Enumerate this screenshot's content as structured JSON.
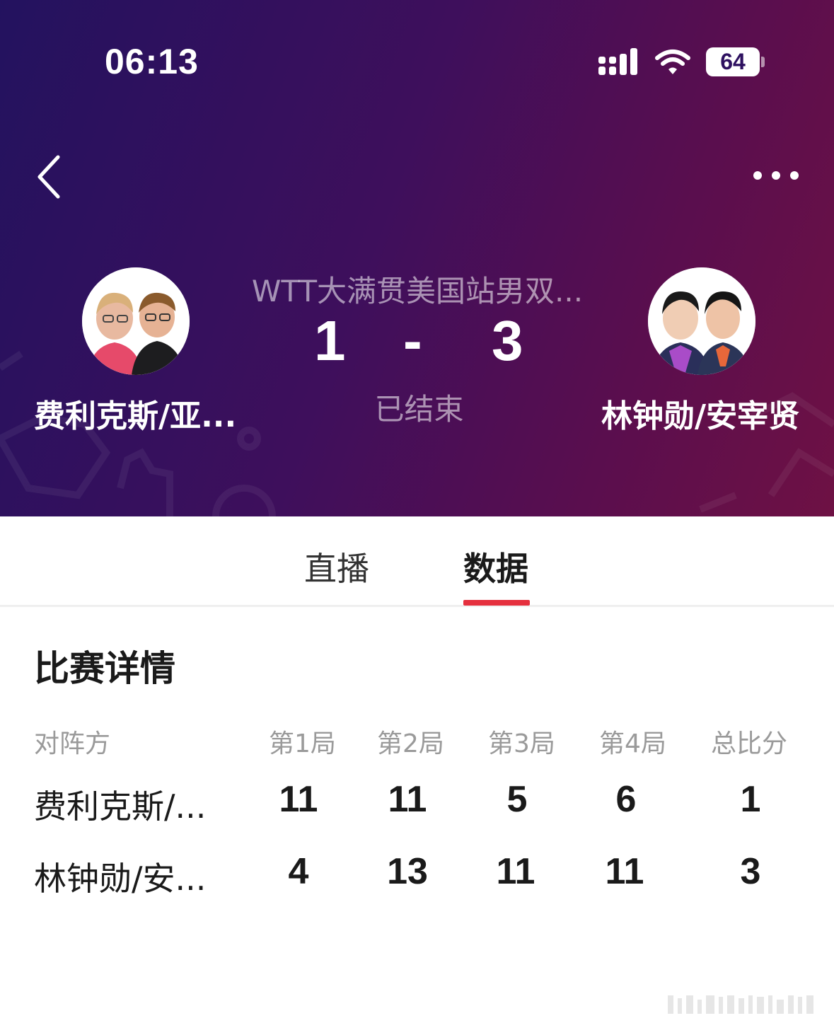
{
  "status_bar": {
    "time": "06:13",
    "battery": "64",
    "icons": [
      "signal-icon",
      "wifi-icon",
      "battery-icon"
    ]
  },
  "nav": {
    "back_icon": "chevron-left-icon",
    "more_icon": "more-dots-icon"
  },
  "match": {
    "event": "WTT大满贯美国站男双...",
    "home": {
      "name": "费利克斯/亚...",
      "score": "1"
    },
    "separator": "-",
    "away": {
      "name": "林钟勋/安宰贤",
      "score": "3"
    },
    "status": "已结束"
  },
  "tabs": [
    {
      "label": "直播",
      "active": false
    },
    {
      "label": "数据",
      "active": true
    }
  ],
  "colors": {
    "accent": "#e5303e",
    "header_start": "#23125f",
    "header_end": "#6e1144"
  },
  "details": {
    "title": "比赛详情",
    "headers": [
      "对阵方",
      "第1局",
      "第2局",
      "第3局",
      "第4局",
      "总比分"
    ],
    "rows": [
      {
        "name": "费利克斯/...",
        "games": [
          "11",
          "11",
          "5",
          "6"
        ],
        "total": "1"
      },
      {
        "name": "林钟勋/安...",
        "games": [
          "4",
          "13",
          "11",
          "11"
        ],
        "total": "3"
      }
    ]
  }
}
